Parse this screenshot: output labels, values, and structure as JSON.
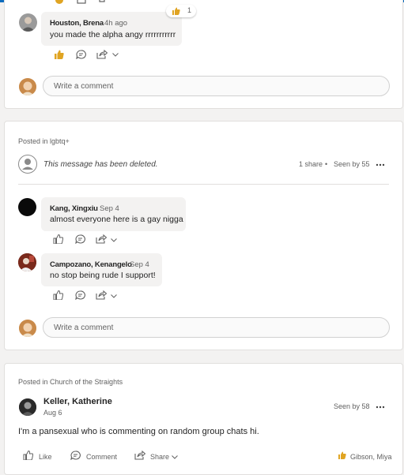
{
  "colors": {
    "accent": "#0f6cbd",
    "reaction": "#e0a422"
  },
  "post1": {
    "comment": {
      "author": "Houston, Brena",
      "time": "4h ago",
      "text": "you made the alpha angy rrrrrrrrrrr",
      "reaction_icon": "thumbs-up-icon",
      "reaction_count": "1"
    },
    "input_placeholder": "Write a comment"
  },
  "post2": {
    "posted_in": "Posted in lgbtq+",
    "deleted_text": "This message has been deleted.",
    "shares": "1 share",
    "separator": "•",
    "seen_by": "Seen by 55",
    "comments": [
      {
        "author": "Kang, Xingxiu",
        "time": "Sep 4",
        "text": "almost everyone here is a gay nigga"
      },
      {
        "author": "Campozano, Kenangelo",
        "time": "Sep 4",
        "text": "no stop being rude I support!"
      }
    ],
    "input_placeholder": "Write a comment"
  },
  "post3": {
    "posted_in": "Posted in Church of the Straights",
    "author": "Keller, Katherine",
    "date": "Aug 6",
    "seen_by": "Seen by 58",
    "text": "I'm a pansexual who is commenting on random group chats hi.",
    "actions": {
      "like": "Like",
      "comment": "Comment",
      "share": "Share"
    },
    "reactor": "Gibson, Miya"
  }
}
